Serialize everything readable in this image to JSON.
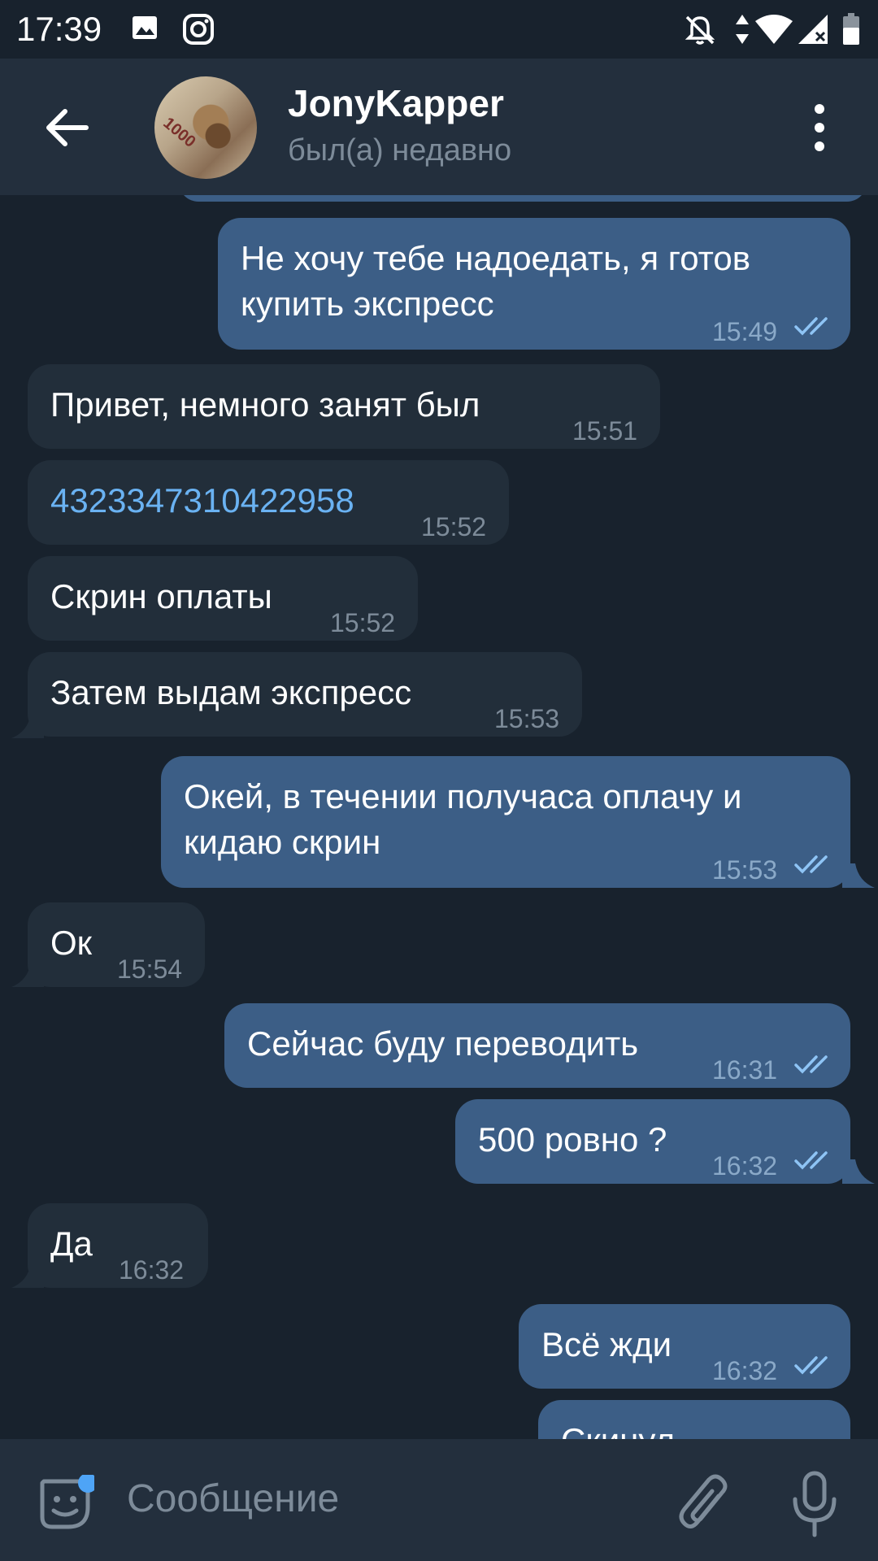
{
  "status_bar": {
    "time": "17:39",
    "icons": [
      "image-icon",
      "instagram-icon",
      "mute-icon",
      "data-arrows-icon",
      "wifi-icon",
      "signal-icon",
      "battery-icon"
    ]
  },
  "header": {
    "title": "JonyKapper",
    "subtitle": "был(а) недавно",
    "avatar_text": "1000"
  },
  "messages": [
    {
      "dir": "out",
      "line1": "Не хочу тебе надоедать, я готов",
      "line2": "купить экспресс",
      "time": "15:49"
    },
    {
      "dir": "in",
      "text": "Привет, немного занят был",
      "time": "15:51"
    },
    {
      "dir": "in",
      "text": "4323347310422958",
      "time": "15:52",
      "link": true
    },
    {
      "dir": "in",
      "text": "Скрин оплаты",
      "time": "15:52"
    },
    {
      "dir": "in",
      "text": "Затем выдам экспресс",
      "time": "15:53"
    },
    {
      "dir": "out",
      "line1": "Окей, в течении получаса оплачу и",
      "line2": "кидаю скрин",
      "time": "15:53"
    },
    {
      "dir": "in",
      "text": "Ок",
      "time": "15:54"
    },
    {
      "dir": "out",
      "text": "Сейчас буду переводить",
      "time": "16:31"
    },
    {
      "dir": "out",
      "text": "500 ровно ?",
      "time": "16:32"
    },
    {
      "dir": "in",
      "text": "Да",
      "time": "16:32"
    },
    {
      "dir": "out",
      "text": "Всё жди",
      "time": "16:32"
    },
    {
      "dir": "out",
      "text": "Скинул",
      "time": ""
    }
  ],
  "input": {
    "placeholder": "Сообщение"
  },
  "colors": {
    "background": "#18222d",
    "header": "#232f3d",
    "outgoing_bubble": "#3c5e86",
    "incoming_bubble": "#222e3a",
    "link": "#6ab2f2",
    "accent": "#4ea4f6"
  }
}
